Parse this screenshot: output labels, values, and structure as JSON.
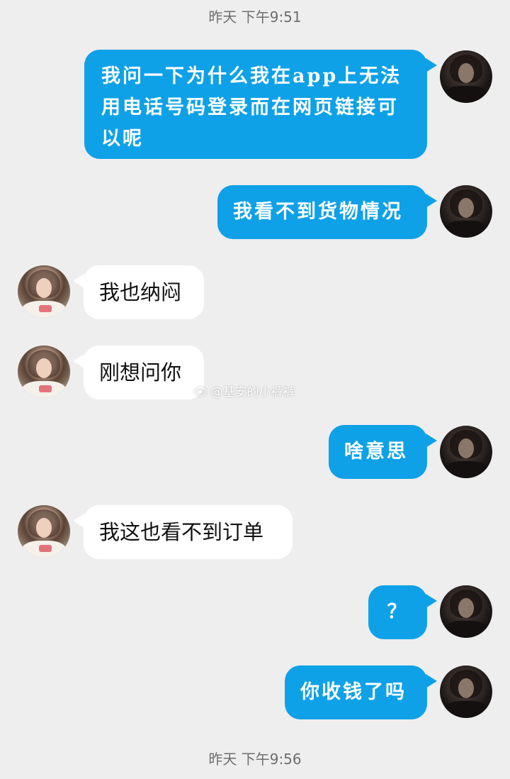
{
  "timestamps": {
    "top": "昨天 下午9:51",
    "bottom": "昨天 下午9:56"
  },
  "messages": [
    {
      "side": "out",
      "text": "我问一下为什么我在app上无法用电话号码登录而在网页链接可以呢"
    },
    {
      "side": "out",
      "text": "我看不到货物情况"
    },
    {
      "side": "in",
      "text": "我也纳闷"
    },
    {
      "side": "in",
      "text": "刚想问你"
    },
    {
      "side": "out",
      "text": "啥意思"
    },
    {
      "side": "in",
      "text": "我这也看不到订单"
    },
    {
      "side": "out",
      "text": "？"
    },
    {
      "side": "out",
      "text": "你收钱了吗"
    }
  ],
  "watermark": {
    "icon": "weibo-logo-icon",
    "text": "@基安的小裤裤"
  },
  "colors": {
    "background": "#eeeeee",
    "outgoing_bubble": "#0ea1e7",
    "incoming_bubble": "#ffffff",
    "timestamp_text": "#6e6e6e"
  }
}
